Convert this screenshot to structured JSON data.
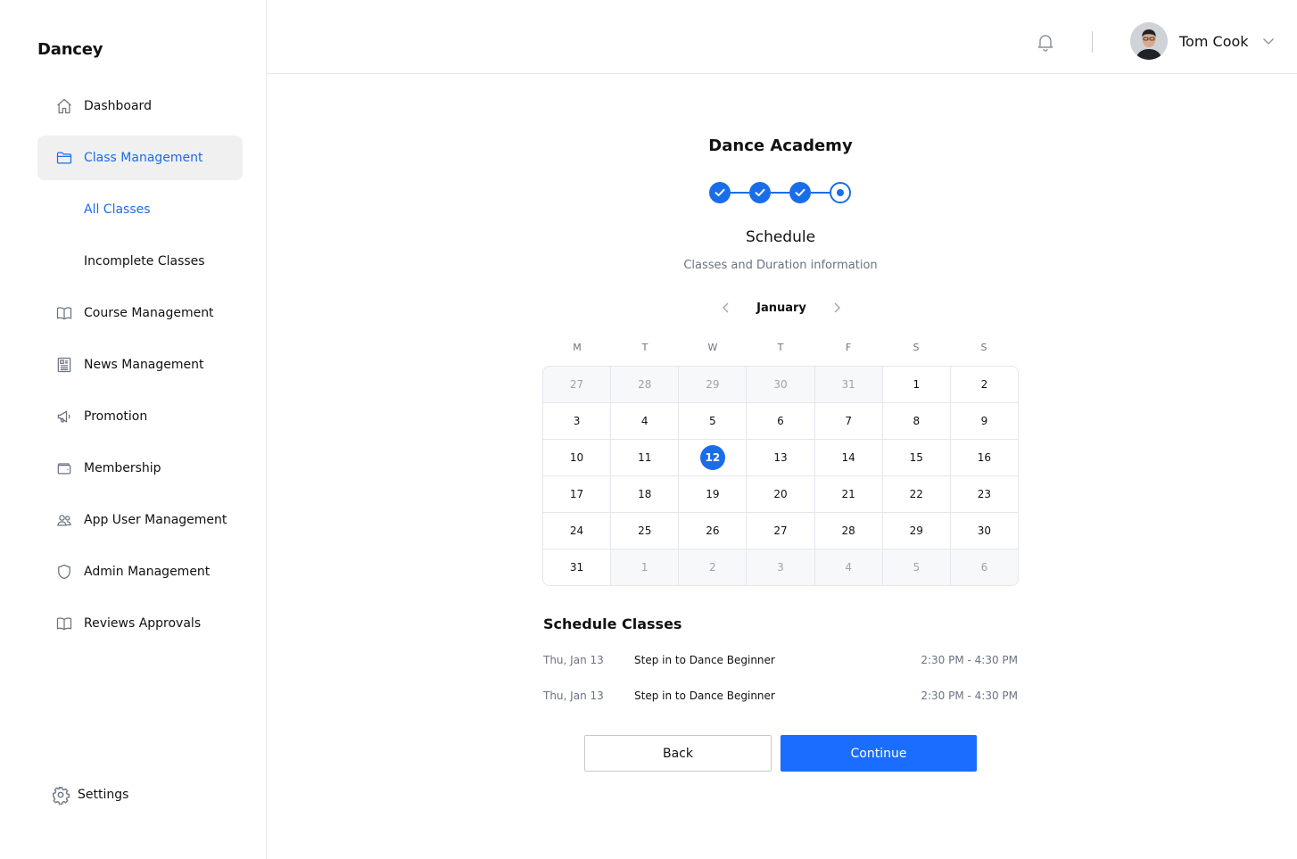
{
  "brand": "Dancey",
  "sidebar": {
    "items": [
      {
        "label": "Dashboard",
        "icon": "home-icon"
      },
      {
        "label": "Class Management",
        "icon": "folder-icon"
      },
      {
        "label": "All Classes"
      },
      {
        "label": "Incomplete Classes"
      },
      {
        "label": "Course Management",
        "icon": "book-icon"
      },
      {
        "label": "News Management",
        "icon": "newspaper-icon"
      },
      {
        "label": "Promotion",
        "icon": "megaphone-icon"
      },
      {
        "label": "Membership",
        "icon": "wallet-icon"
      },
      {
        "label": "App User Management",
        "icon": "users-icon"
      },
      {
        "label": "Admin Management",
        "icon": "shield-icon"
      },
      {
        "label": "Reviews Approvals",
        "icon": "book-icon"
      }
    ],
    "settings": "Settings"
  },
  "header": {
    "user_name": "Tom Cook"
  },
  "main": {
    "title": "Dance Academy",
    "steps": [
      "done",
      "done",
      "done",
      "current"
    ],
    "section_title": "Schedule",
    "section_subtitle": "Classes and Duration information",
    "month": "January",
    "weekdays": [
      "M",
      "T",
      "W",
      "T",
      "F",
      "S",
      "S"
    ],
    "calendar": [
      [
        "27",
        "28",
        "29",
        "30",
        "31",
        "1",
        "2"
      ],
      [
        "3",
        "4",
        "5",
        "6",
        "7",
        "8",
        "9"
      ],
      [
        "10",
        "11",
        "12",
        "13",
        "14",
        "15",
        "16"
      ],
      [
        "17",
        "18",
        "19",
        "20",
        "21",
        "22",
        "23"
      ],
      [
        "24",
        "25",
        "26",
        "27",
        "28",
        "29",
        "30"
      ],
      [
        "31",
        "1",
        "2",
        "3",
        "4",
        "5",
        "6"
      ]
    ],
    "selected_day": "12",
    "schedule_title": "Schedule Classes",
    "schedule": [
      {
        "date": "Thu, Jan 13",
        "class": "Step in to Dance Beginner",
        "time": "2:30 PM - 4:30 PM"
      },
      {
        "date": "Thu, Jan 13",
        "class": "Step in to Dance Beginner",
        "time": "2:30 PM - 4:30 PM"
      }
    ],
    "back_label": "Back",
    "continue_label": "Continue"
  },
  "colors": {
    "accent": "#1a6de8",
    "button_primary": "#1a6dff"
  }
}
